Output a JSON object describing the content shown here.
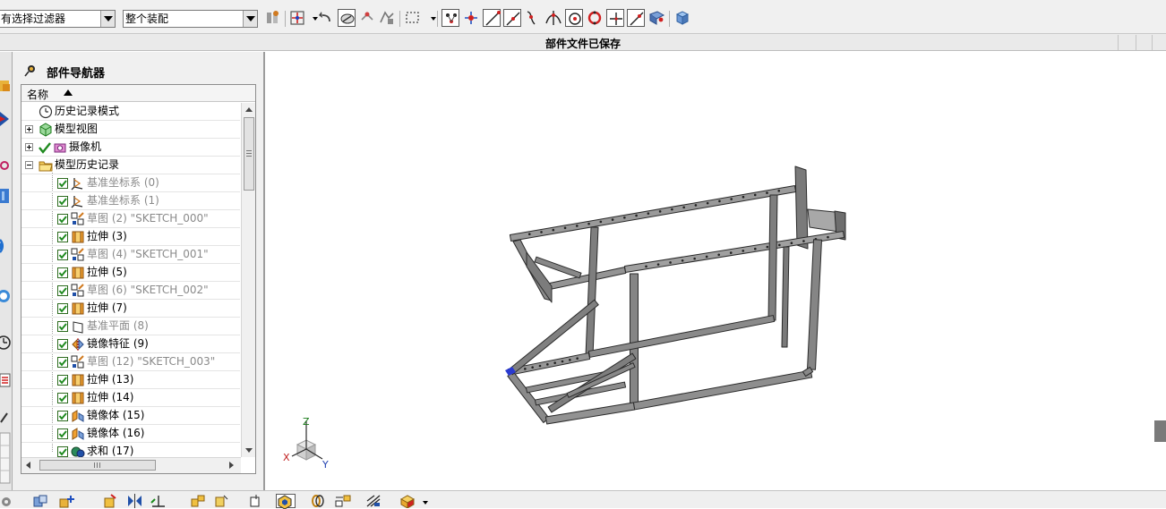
{
  "toolbar": {
    "selection_filter": "有选择过滤器",
    "assembly_scope": "整个装配"
  },
  "status": {
    "message": "部件文件已保存"
  },
  "navigator": {
    "title": "部件导航器",
    "column_name": "名称",
    "items": [
      {
        "label": "历史记录模式",
        "dim": false,
        "icon": "clock-icon",
        "checked": null
      },
      {
        "label": "模型视图",
        "dim": false,
        "icon": "model-views-icon",
        "checked": null
      },
      {
        "label": "摄像机",
        "dim": false,
        "icon": "camera-icon",
        "checked": null
      },
      {
        "label": "模型历史记录",
        "dim": false,
        "icon": "folder-icon",
        "checked": null
      },
      {
        "label": "基准坐标系 (0)",
        "dim": true,
        "icon": "datum-csys-icon",
        "checked": true
      },
      {
        "label": "基准坐标系 (1)",
        "dim": true,
        "icon": "datum-csys-icon",
        "checked": true
      },
      {
        "label": "草图 (2) \"SKETCH_000\"",
        "dim": true,
        "icon": "sketch-icon",
        "checked": true
      },
      {
        "label": "拉伸 (3)",
        "dim": false,
        "icon": "extrude-icon",
        "checked": true
      },
      {
        "label": "草图 (4) \"SKETCH_001\"",
        "dim": true,
        "icon": "sketch-icon",
        "checked": true
      },
      {
        "label": "拉伸 (5)",
        "dim": false,
        "icon": "extrude-icon",
        "checked": true
      },
      {
        "label": "草图 (6) \"SKETCH_002\"",
        "dim": true,
        "icon": "sketch-icon",
        "checked": true
      },
      {
        "label": "拉伸 (7)",
        "dim": false,
        "icon": "extrude-icon",
        "checked": true
      },
      {
        "label": "基准平面 (8)",
        "dim": true,
        "icon": "datum-plane-icon",
        "checked": true
      },
      {
        "label": "镜像特征 (9)",
        "dim": false,
        "icon": "mirror-feature-icon",
        "checked": true
      },
      {
        "label": "草图 (12) \"SKETCH_003\"",
        "dim": true,
        "icon": "sketch-icon",
        "checked": true
      },
      {
        "label": "拉伸 (13)",
        "dim": false,
        "icon": "extrude-icon",
        "checked": true
      },
      {
        "label": "拉伸 (14)",
        "dim": false,
        "icon": "extrude-icon",
        "checked": true
      },
      {
        "label": "镜像体 (15)",
        "dim": false,
        "icon": "mirror-body-icon",
        "checked": true
      },
      {
        "label": "镜像体 (16)",
        "dim": false,
        "icon": "mirror-body-icon",
        "checked": true
      },
      {
        "label": "求和 (17)",
        "dim": false,
        "icon": "unite-icon",
        "checked": true
      }
    ]
  },
  "viewport": {
    "triad": {
      "x": "X",
      "y": "Y",
      "z": "Z"
    }
  },
  "colors": {
    "frame_fill": "#8d8d8d",
    "frame_edge": "#2a2a2a",
    "check_green": "#1f8a1f"
  }
}
